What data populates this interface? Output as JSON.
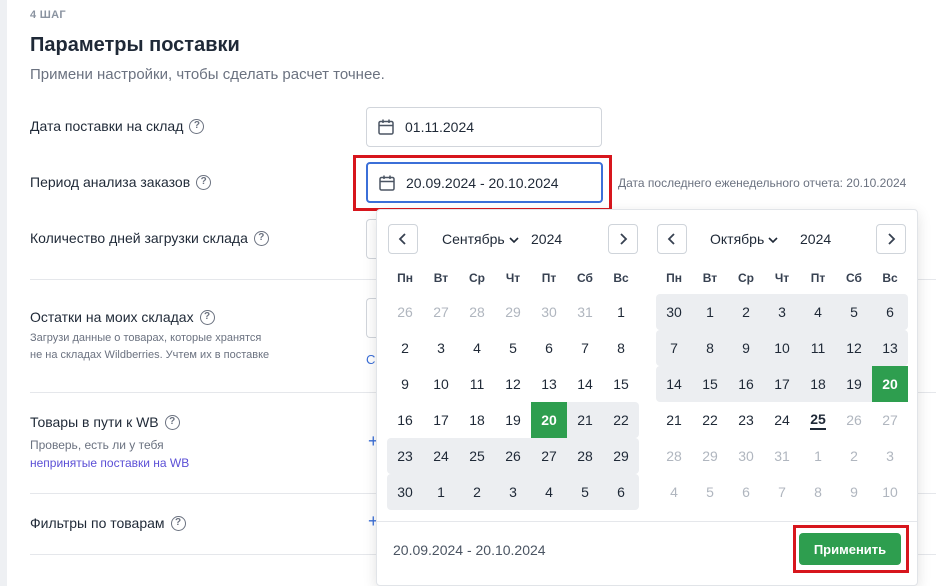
{
  "step": "4 ШАГ",
  "title": "Параметры поставки",
  "subtitle": "Примени настройки, чтобы сделать расчет точнее.",
  "rows": {
    "delivery_date_label": "Дата поставки на склад",
    "delivery_date_value": "01.11.2024",
    "period_label": "Период анализа заказов",
    "period_value": "20.09.2024 - 20.10.2024",
    "period_note": "Дата последнего еженедельного отчета: 20.10.2024",
    "load_days_label": "Количество дней загрузки склада",
    "stock_label": "Остатки на моих складах",
    "stock_desc_line1": "Загрузи данные о товарах, которые хранятся",
    "stock_desc_line2": "не на складах Wildberries. Учтем их в поставке",
    "stock_action_fragment": "С",
    "transit_label": "Товары в пути к WB",
    "transit_desc": "Проверь, есть ли у тебя",
    "transit_link": "непринятые поставки на WB",
    "filters_label": "Фильтры по товарам",
    "plus": "+",
    "help": "?"
  },
  "picker": {
    "weekdays": [
      "Пн",
      "Вт",
      "Ср",
      "Чт",
      "Пт",
      "Сб",
      "Вс"
    ],
    "prev_icon": "chevron-left-icon",
    "next_icon": "chevron-right-icon",
    "left": {
      "month": "Сентябрь",
      "year": "2024",
      "days": [
        {
          "d": "26",
          "s": "out"
        },
        {
          "d": "27",
          "s": "out"
        },
        {
          "d": "28",
          "s": "out"
        },
        {
          "d": "29",
          "s": "out"
        },
        {
          "d": "30",
          "s": "out"
        },
        {
          "d": "31",
          "s": "out"
        },
        {
          "d": "1",
          "s": ""
        },
        {
          "d": "2",
          "s": ""
        },
        {
          "d": "3",
          "s": ""
        },
        {
          "d": "4",
          "s": ""
        },
        {
          "d": "5",
          "s": ""
        },
        {
          "d": "6",
          "s": ""
        },
        {
          "d": "7",
          "s": ""
        },
        {
          "d": "8",
          "s": ""
        },
        {
          "d": "9",
          "s": ""
        },
        {
          "d": "10",
          "s": ""
        },
        {
          "d": "11",
          "s": ""
        },
        {
          "d": "12",
          "s": ""
        },
        {
          "d": "13",
          "s": ""
        },
        {
          "d": "14",
          "s": ""
        },
        {
          "d": "15",
          "s": ""
        },
        {
          "d": "16",
          "s": ""
        },
        {
          "d": "17",
          "s": ""
        },
        {
          "d": "18",
          "s": ""
        },
        {
          "d": "19",
          "s": ""
        },
        {
          "d": "20",
          "s": "sel"
        },
        {
          "d": "21",
          "s": "range"
        },
        {
          "d": "22",
          "s": "range"
        },
        {
          "d": "23",
          "s": "range"
        },
        {
          "d": "24",
          "s": "range"
        },
        {
          "d": "25",
          "s": "range"
        },
        {
          "d": "26",
          "s": "range"
        },
        {
          "d": "27",
          "s": "range"
        },
        {
          "d": "28",
          "s": "range"
        },
        {
          "d": "29",
          "s": "range"
        },
        {
          "d": "30",
          "s": "range"
        },
        {
          "d": "1",
          "s": "range"
        },
        {
          "d": "2",
          "s": "range"
        },
        {
          "d": "3",
          "s": "range"
        },
        {
          "d": "4",
          "s": "range"
        },
        {
          "d": "5",
          "s": "range"
        },
        {
          "d": "6",
          "s": "range"
        }
      ]
    },
    "right": {
      "month": "Октябрь",
      "year": "2024",
      "days": [
        {
          "d": "30",
          "s": "range"
        },
        {
          "d": "1",
          "s": "range"
        },
        {
          "d": "2",
          "s": "range"
        },
        {
          "d": "3",
          "s": "range"
        },
        {
          "d": "4",
          "s": "range"
        },
        {
          "d": "5",
          "s": "range"
        },
        {
          "d": "6",
          "s": "range"
        },
        {
          "d": "7",
          "s": "range"
        },
        {
          "d": "8",
          "s": "range"
        },
        {
          "d": "9",
          "s": "range"
        },
        {
          "d": "10",
          "s": "range"
        },
        {
          "d": "11",
          "s": "range"
        },
        {
          "d": "12",
          "s": "range"
        },
        {
          "d": "13",
          "s": "range"
        },
        {
          "d": "14",
          "s": "range"
        },
        {
          "d": "15",
          "s": "range"
        },
        {
          "d": "16",
          "s": "range"
        },
        {
          "d": "17",
          "s": "range"
        },
        {
          "d": "18",
          "s": "range"
        },
        {
          "d": "19",
          "s": "range"
        },
        {
          "d": "20",
          "s": "sel"
        },
        {
          "d": "21",
          "s": ""
        },
        {
          "d": "22",
          "s": ""
        },
        {
          "d": "23",
          "s": ""
        },
        {
          "d": "24",
          "s": ""
        },
        {
          "d": "25",
          "s": "today"
        },
        {
          "d": "26",
          "s": "out"
        },
        {
          "d": "27",
          "s": "out"
        },
        {
          "d": "28",
          "s": "out"
        },
        {
          "d": "29",
          "s": "out"
        },
        {
          "d": "30",
          "s": "out"
        },
        {
          "d": "31",
          "s": "out"
        },
        {
          "d": "1",
          "s": "out"
        },
        {
          "d": "2",
          "s": "out"
        },
        {
          "d": "3",
          "s": "out"
        },
        {
          "d": "4",
          "s": "out"
        },
        {
          "d": "5",
          "s": "out"
        },
        {
          "d": "6",
          "s": "out"
        },
        {
          "d": "7",
          "s": "out"
        },
        {
          "d": "8",
          "s": "out"
        },
        {
          "d": "9",
          "s": "out"
        },
        {
          "d": "10",
          "s": "out"
        }
      ]
    },
    "range_text": "20.09.2024 - 20.10.2024",
    "apply_label": "Применить"
  },
  "colors": {
    "accent_green": "#2e9e4f",
    "highlight_red": "#d7161d",
    "focus_blue": "#3b6fd8"
  }
}
